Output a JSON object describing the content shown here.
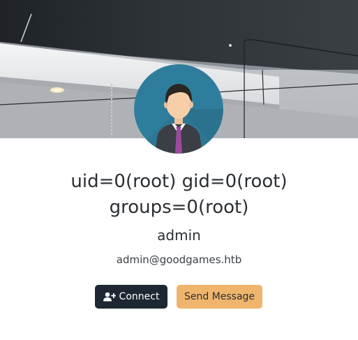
{
  "profile": {
    "cover_image": "ceiling-lights-photo",
    "avatar_icon": "user-avatar-icon",
    "name_line1": "uid=0(root) gid=0(root)",
    "name_line2": "groups=0(root)",
    "username": "admin",
    "email": "admin@goodgames.htb"
  },
  "actions": {
    "connect_label": "Connect",
    "connect_icon": "user-plus-icon",
    "message_label": "Send Message"
  },
  "colors": {
    "connect_bg": "#1e2833",
    "message_bg": "#f0b56c",
    "avatar_bg": "#2f7d9c"
  }
}
